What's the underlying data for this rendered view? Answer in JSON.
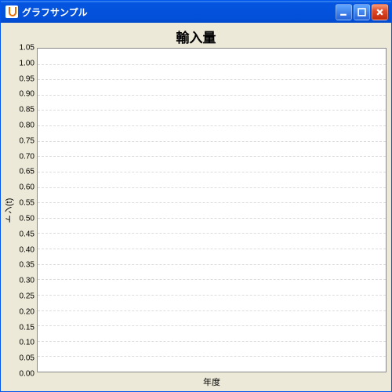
{
  "window": {
    "title": "グラフサンプル"
  },
  "chart_data": {
    "type": "bar",
    "title": "輸入量",
    "xlabel": "年度",
    "ylabel": "トン(t)",
    "categories": [],
    "values": [],
    "ylim": [
      0.0,
      1.05
    ],
    "ytick_step": 0.05,
    "yticks": [
      "0.00",
      "0.05",
      "0.10",
      "0.15",
      "0.20",
      "0.25",
      "0.30",
      "0.35",
      "0.40",
      "0.45",
      "0.50",
      "0.55",
      "0.60",
      "0.65",
      "0.70",
      "0.75",
      "0.80",
      "0.85",
      "0.90",
      "0.95",
      "1.00",
      "1.05"
    ]
  }
}
